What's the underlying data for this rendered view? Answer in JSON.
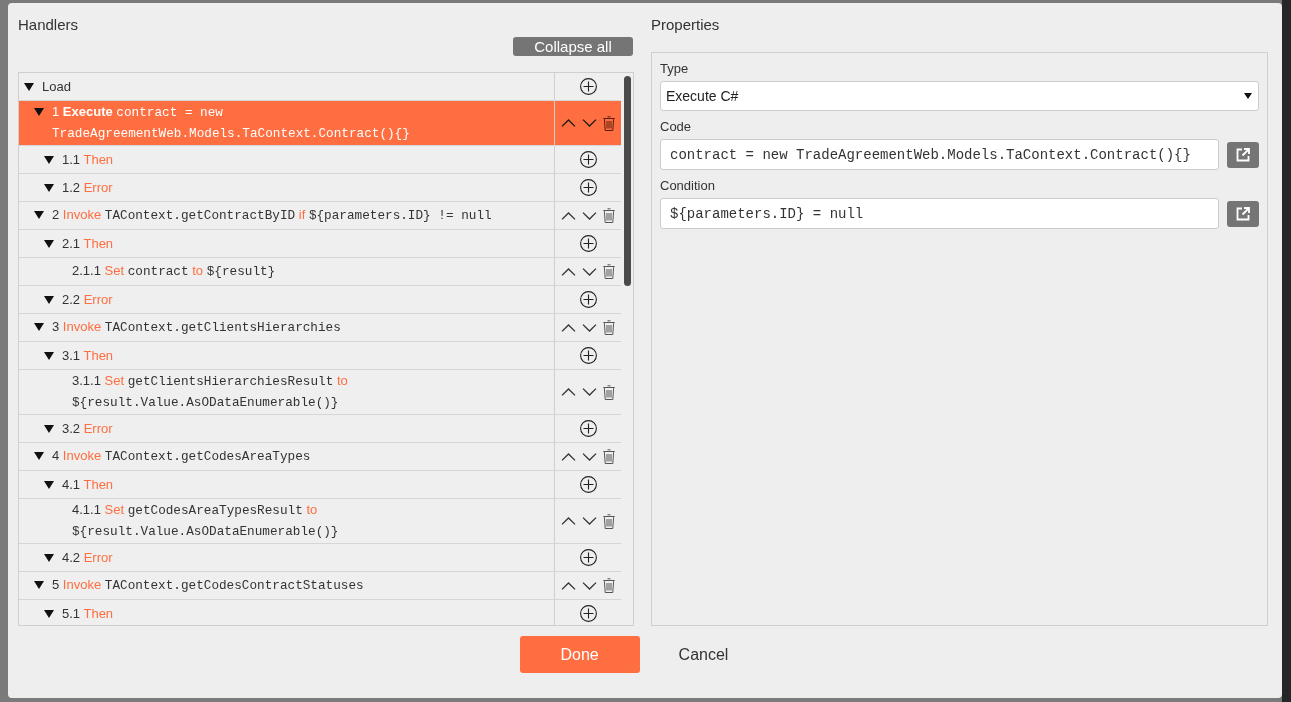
{
  "handlers": {
    "title": "Handlers",
    "collapse_button": "Collapse all",
    "tree": [
      {
        "kind": "branch",
        "expanded": true,
        "selected": false,
        "parts": [
          {
            "kind": "text",
            "text": "Load"
          }
        ],
        "children": [
          {
            "kind": "step",
            "number": "1",
            "expanded": true,
            "selected": true,
            "parts": [
              {
                "kind": "keyword",
                "text": "Execute"
              },
              {
                "kind": "code",
                "text": "contract = new TradeAgreementWeb.Models.TaContext.Contract(){}"
              }
            ],
            "children": [
              {
                "kind": "branch",
                "number": "1.1",
                "expanded": true,
                "selected": false,
                "parts": [
                  {
                    "kind": "keyword",
                    "text": "Then"
                  }
                ]
              },
              {
                "kind": "branch",
                "number": "1.2",
                "expanded": true,
                "selected": false,
                "parts": [
                  {
                    "kind": "keyword",
                    "text": "Error"
                  }
                ]
              }
            ]
          },
          {
            "kind": "step",
            "number": "2",
            "expanded": true,
            "selected": false,
            "parts": [
              {
                "kind": "keyword",
                "text": "Invoke"
              },
              {
                "kind": "code",
                "text": "TAContext.getContractByID"
              },
              {
                "kind": "keyword",
                "text": "if"
              },
              {
                "kind": "code",
                "text": "${parameters.ID} != null"
              }
            ],
            "children": [
              {
                "kind": "branch",
                "number": "2.1",
                "expanded": true,
                "selected": false,
                "parts": [
                  {
                    "kind": "keyword",
                    "text": "Then"
                  }
                ],
                "children": [
                  {
                    "kind": "step",
                    "number": "2.1.1",
                    "selected": false,
                    "parts": [
                      {
                        "kind": "keyword",
                        "text": "Set"
                      },
                      {
                        "kind": "code",
                        "text": "contract"
                      },
                      {
                        "kind": "keyword",
                        "text": "to"
                      },
                      {
                        "kind": "code",
                        "text": "${result}"
                      }
                    ]
                  }
                ]
              },
              {
                "kind": "branch",
                "number": "2.2",
                "expanded": true,
                "selected": false,
                "parts": [
                  {
                    "kind": "keyword",
                    "text": "Error"
                  }
                ]
              }
            ]
          },
          {
            "kind": "step",
            "number": "3",
            "expanded": true,
            "selected": false,
            "parts": [
              {
                "kind": "keyword",
                "text": "Invoke"
              },
              {
                "kind": "code",
                "text": "TAContext.getClientsHierarchies"
              }
            ],
            "children": [
              {
                "kind": "branch",
                "number": "3.1",
                "expanded": true,
                "selected": false,
                "parts": [
                  {
                    "kind": "keyword",
                    "text": "Then"
                  }
                ],
                "children": [
                  {
                    "kind": "step",
                    "number": "3.1.1",
                    "selected": false,
                    "parts": [
                      {
                        "kind": "keyword",
                        "text": "Set"
                      },
                      {
                        "kind": "code",
                        "text": "getClientsHierarchiesResult"
                      },
                      {
                        "kind": "keyword",
                        "text": "to"
                      },
                      {
                        "kind": "code",
                        "text": "${result.Value.AsODataEnumerable()}"
                      }
                    ]
                  }
                ]
              },
              {
                "kind": "branch",
                "number": "3.2",
                "expanded": true,
                "selected": false,
                "parts": [
                  {
                    "kind": "keyword",
                    "text": "Error"
                  }
                ]
              }
            ]
          },
          {
            "kind": "step",
            "number": "4",
            "expanded": true,
            "selected": false,
            "parts": [
              {
                "kind": "keyword",
                "text": "Invoke"
              },
              {
                "kind": "code",
                "text": "TAContext.getCodesAreaTypes"
              }
            ],
            "children": [
              {
                "kind": "branch",
                "number": "4.1",
                "expanded": true,
                "selected": false,
                "parts": [
                  {
                    "kind": "keyword",
                    "text": "Then"
                  }
                ],
                "children": [
                  {
                    "kind": "step",
                    "number": "4.1.1",
                    "selected": false,
                    "parts": [
                      {
                        "kind": "keyword",
                        "text": "Set"
                      },
                      {
                        "kind": "code",
                        "text": "getCodesAreaTypesResult"
                      },
                      {
                        "kind": "keyword",
                        "text": "to"
                      },
                      {
                        "kind": "code",
                        "text": "${result.Value.AsODataEnumerable()}"
                      }
                    ]
                  }
                ]
              },
              {
                "kind": "branch",
                "number": "4.2",
                "expanded": true,
                "selected": false,
                "parts": [
                  {
                    "kind": "keyword",
                    "text": "Error"
                  }
                ]
              }
            ]
          },
          {
            "kind": "step",
            "number": "5",
            "expanded": true,
            "selected": false,
            "parts": [
              {
                "kind": "keyword",
                "text": "Invoke"
              },
              {
                "kind": "code",
                "text": "TAContext.getCodesContractStatuses"
              }
            ],
            "children": [
              {
                "kind": "branch",
                "number": "5.1",
                "expanded": true,
                "selected": false,
                "parts": [
                  {
                    "kind": "keyword",
                    "text": "Then"
                  }
                ]
              }
            ]
          }
        ]
      }
    ]
  },
  "properties": {
    "title": "Properties",
    "fields": [
      {
        "kind": "select",
        "label": "Type",
        "value": "Execute C#"
      },
      {
        "kind": "code",
        "label": "Code",
        "value": "contract = new TradeAgreementWeb.Models.TaContext.Contract(){}"
      },
      {
        "kind": "code",
        "label": "Condition",
        "value": "${parameters.ID} = null"
      }
    ]
  },
  "footer": {
    "buttons": [
      {
        "kind": "primary",
        "label": "Done"
      },
      {
        "kind": "plain",
        "label": "Cancel"
      }
    ]
  }
}
